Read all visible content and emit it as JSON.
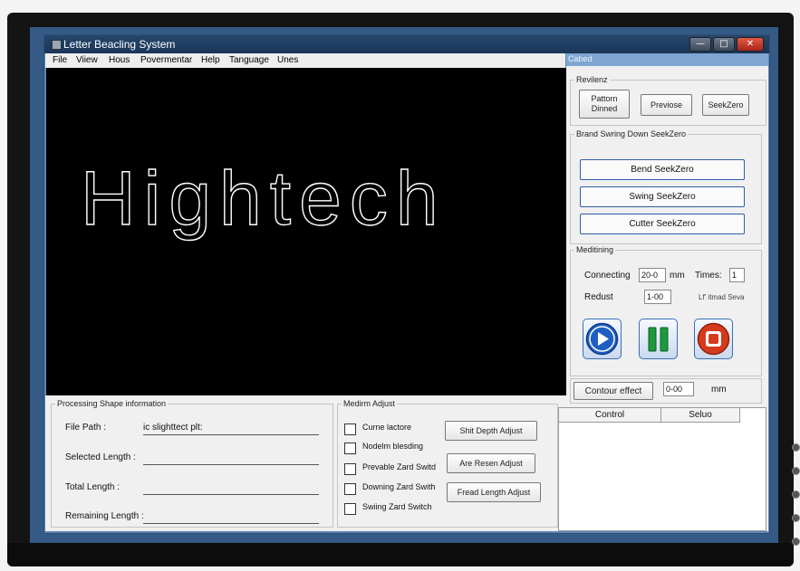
{
  "window": {
    "title": "Letter Beacling System",
    "min_glyph": "—",
    "max_glyph": "□",
    "close_glyph": "✕"
  },
  "menu": {
    "items": [
      "File",
      "Viiew",
      "Hous",
      "Povermentar",
      "Help",
      "Tanguage",
      "Unes"
    ]
  },
  "canvas": {
    "text": "Hightech"
  },
  "right_panel": {
    "header": "Cabed",
    "reviews": {
      "legend": "Revilenz",
      "pattern_button": "Pattorn Dinned",
      "previous_button": "Previose",
      "seekzero_button": "SeekZero"
    },
    "seekzero_group": {
      "legend": "Brand Swring Down SeekZero",
      "bend": "Bend SeekZero",
      "swing": "Swing SeekZero",
      "cutter": "Cutter SeekZero"
    },
    "meditining": {
      "legend": "Meditining",
      "connecting_label": "Connecting",
      "connecting_value": "20-0",
      "connecting_unit": "mm",
      "times_label": "Times:",
      "times_value": "1",
      "redust_label": "Redust",
      "redust_value": "1-00",
      "extra_label": "Lf' itmad Seva"
    },
    "contour": {
      "button": "Contour effect",
      "value": "0-00",
      "unit": "mm"
    }
  },
  "processing": {
    "legend": "Processing Shape information",
    "file_path_label": "File Path :",
    "file_path_value": "ic slighttect plt:",
    "selected_length_label": "Selected Length :",
    "total_length_label": "Total Length :",
    "remaining_length_label": "Remaining Length :"
  },
  "adjust": {
    "legend": "Medirm Adjust",
    "checks": [
      {
        "label": "Curne lactore"
      },
      {
        "label": "Nodelm blesding"
      },
      {
        "label": "Prevable Zard Switd"
      },
      {
        "label": "Downing Zard Swith"
      },
      {
        "label": "Swiing Zard Switch"
      }
    ],
    "buttons": {
      "shift_depth": "Shit Depth Adjust",
      "resen": "Are Resen Adjust",
      "fread_length": "Fread Length Adjust"
    }
  },
  "tabs": {
    "control": "Control",
    "setup": "Seluo"
  },
  "colors": {
    "screen_blue": "#345a85",
    "window_blue": "#5d87b5",
    "title_bar": "#1f3d63",
    "play_blue": "#1f5fc4",
    "pause_green": "#1d9a3c",
    "stop_red": "#d63a1c",
    "wide_button_border": "#2f5ea6"
  },
  "icons": [
    "app-icon",
    "minimize-icon",
    "maximize-icon",
    "close-icon",
    "play-icon",
    "pause-icon",
    "stop-icon"
  ]
}
